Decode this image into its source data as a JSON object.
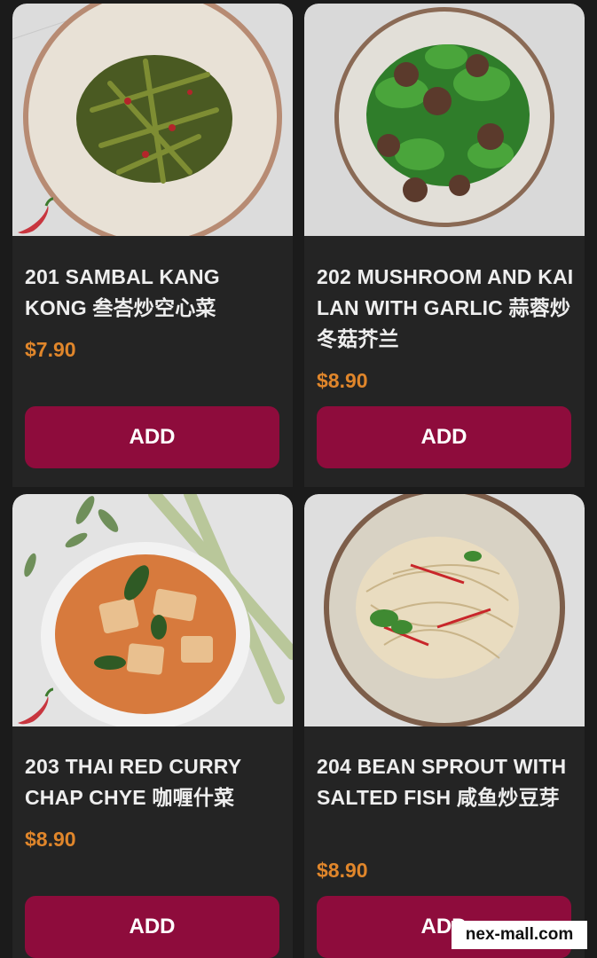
{
  "menu": {
    "items": [
      {
        "title": "201 SAMBAL KANG KONG 叁峇炒空心菜",
        "price": "$7.90",
        "add_label": "ADD",
        "spicy": true,
        "icon": "chili-icon"
      },
      {
        "title": "202 MUSHROOM AND KAI LAN WITH GARLIC 蒜蓉炒冬菇芥兰",
        "price": "$8.90",
        "add_label": "ADD",
        "spicy": false
      },
      {
        "title": "203 THAI RED CURRY CHAP CHYE 咖喱什菜",
        "price": "$8.90",
        "add_label": "ADD",
        "spicy": true,
        "icon": "chili-icon"
      },
      {
        "title": "204 BEAN SPROUT WITH SALTED FISH 咸鱼炒豆芽",
        "price": "$8.90",
        "add_label": "ADD",
        "spicy": false
      }
    ]
  },
  "watermark": "nex-mall.com",
  "colors": {
    "background": "#1b1b1b",
    "card": "#242424",
    "price": "#e0862b",
    "add_button": "#8e0c3c"
  }
}
